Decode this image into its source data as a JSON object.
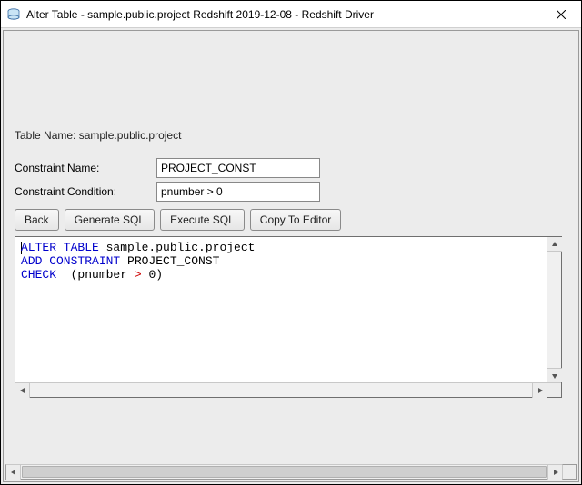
{
  "window": {
    "title": "Alter Table - sample.public.project Redshift 2019-12-08 - Redshift Driver"
  },
  "form": {
    "table_name_label": "Table Name: sample.public.project",
    "constraint_name_label": "Constraint Name:",
    "constraint_name_value": "PROJECT_CONST",
    "constraint_condition_label": "Constraint Condition:",
    "constraint_condition_value": "pnumber > 0"
  },
  "buttons": {
    "back": "Back",
    "generate_sql": "Generate SQL",
    "execute_sql": "Execute SQL",
    "copy_to_editor": "Copy To Editor"
  },
  "sql": {
    "kw_alter_table": "ALTER TABLE",
    "target": " sample.public.project",
    "kw_add_constraint": "ADD CONSTRAINT",
    "constraint_name": " PROJECT_CONST",
    "kw_check": "CHECK",
    "open": "  (pnumber ",
    "op": ">",
    "close": " 0)"
  }
}
